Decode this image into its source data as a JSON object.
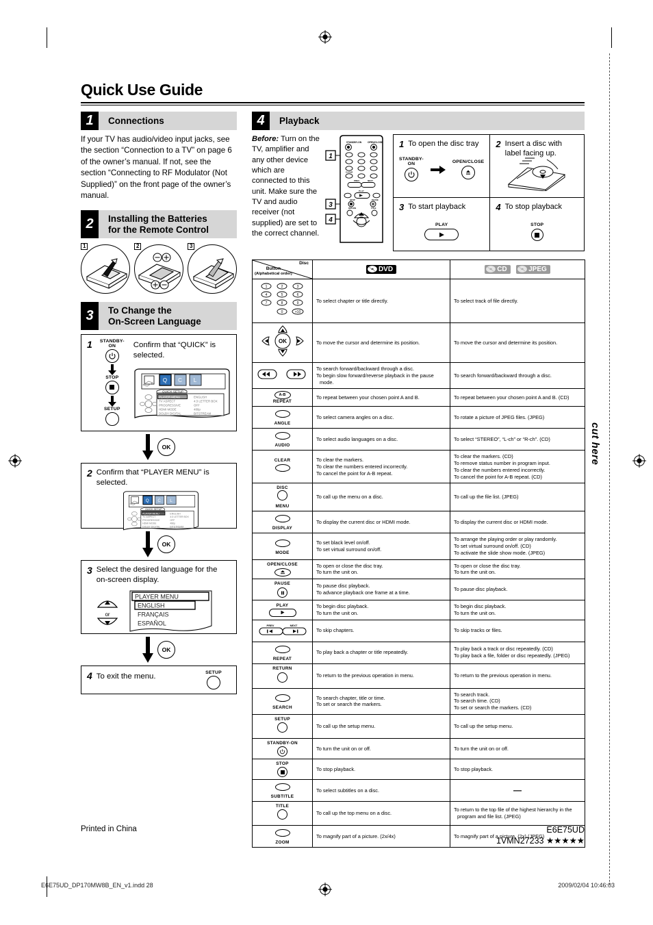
{
  "document": {
    "title": "Quick Use Guide",
    "printed_in": "Printed in China",
    "model_code": "E6E75UD",
    "part_number": "1VMN27233",
    "stars": "★★★★★",
    "cut_here": "cut here",
    "indd_file": "E6E75UD_DP170MW8B_EN_v1.indd   28",
    "print_timestamp": "2009/02/04   10:46:03"
  },
  "sections": {
    "connections": {
      "number": "1",
      "title": "Connections",
      "body": "If your TV has audio/video input jacks, see the section “Connection to a TV” on page 6 of the owner’s manual. If not, see the section “Connecting to RF Modulator (Not Supplied)” on the front page of the owner’s manual."
    },
    "batteries": {
      "number": "2",
      "title_line1": "Installing the Batteries",
      "title_line2": "for the Remote Control",
      "steps": [
        "1",
        "2",
        "3"
      ]
    },
    "language": {
      "number": "3",
      "title_line1": "To Change the",
      "title_line2": "On-Screen Language",
      "step1": {
        "num": "1",
        "text": "Confirm that “QUICK” is selected.",
        "buttons": [
          "STANDBY-ON",
          "STOP",
          "SETUP"
        ]
      },
      "step2": {
        "num": "2",
        "text": "Confirm that “PLAYER MENU” is selected."
      },
      "step3": {
        "num": "3",
        "text": "Select the desired language for the on-screen display.",
        "or_label": "or",
        "menu_title": "PLAYER MENU",
        "menu_options": [
          "ENGLISH",
          "FRANÇAIS",
          "ESPAÑOL"
        ]
      },
      "step4": {
        "num": "4",
        "text": "To exit the menu.",
        "button": "SETUP"
      },
      "ok_label": "OK",
      "osd": {
        "header": "QUICK SETUP",
        "rows": [
          {
            "label": "PLAYER MENU",
            "value": "ENGLISH"
          },
          {
            "label": "TV ASPECT",
            "value": "4:3 LETTER BOX"
          },
          {
            "label": "PROGRESSIVE",
            "value": "OFF"
          },
          {
            "label": "HDMI MODE",
            "value": "480p"
          },
          {
            "label": "DOLBY DIGITAL",
            "value": "BITSTREAM"
          }
        ]
      }
    },
    "playback": {
      "number": "4",
      "title": "Playback",
      "before_label": "Before:",
      "before_text": "Turn on the TV, amplifier and any other device which are connected to this unit. Make sure the TV and audio receiver (not supplied) are set to the correct channel.",
      "remote_callouts": [
        "1",
        "3",
        "4"
      ],
      "remote_labels": {
        "standby": "STANDBY-ON",
        "open_close": "OPEN/CLOSE",
        "clear": "CLEAR",
        "prev": "PREV",
        "next": "NEXT",
        "play": "PLAY",
        "stop": "STOP",
        "return": "RETURN",
        "pause": "PAUSE",
        "title": "TITLE"
      },
      "cells": [
        {
          "num": "1",
          "text": "To open the disc tray",
          "icon_labels": [
            "STANDBY-ON",
            "OPEN/CLOSE"
          ]
        },
        {
          "num": "2",
          "text": "Insert a disc with label facing up.",
          "icon_labels": []
        },
        {
          "num": "3",
          "text": "To start playback",
          "icon_labels": [
            "PLAY"
          ]
        },
        {
          "num": "4",
          "text": "To stop playback",
          "icon_labels": [
            "STOP"
          ]
        }
      ]
    }
  },
  "ops_table": {
    "corner_button_label_1": "Button",
    "corner_button_label_2": "(Alphabetical order)",
    "corner_disc_label": "Disc",
    "col_dvd": "DVD",
    "col_cd": "CD",
    "col_jpeg": "JPEG",
    "rows": [
      {
        "button": "numbers",
        "button_label": "",
        "dvd": [
          "To select chapter or title directly."
        ],
        "cd": [
          "To select track of file directly."
        ]
      },
      {
        "button": "cursor-ok",
        "button_label": "OK",
        "dvd": [
          "To move the cursor and determine its position."
        ],
        "cd": [
          "To move the cursor and determine its position."
        ]
      },
      {
        "button": "search-fwd-rev",
        "button_label": "",
        "dvd": [
          "To search forward/backward through a disc.",
          "To begin slow forward/reverse playback in the pause mode."
        ],
        "cd": [
          "To search forward/backward through a disc."
        ]
      },
      {
        "button": "ab-repeat",
        "button_label": "REPEAT",
        "button_inner": "A-B",
        "dvd": [
          "To repeat between your chosen point A and B."
        ],
        "cd": [
          "To repeat between your chosen point A and B. (CD)"
        ]
      },
      {
        "button": "angle",
        "button_label": "ANGLE",
        "dvd": [
          "To select camera angles on a disc."
        ],
        "cd": [
          "To rotate a picture of JPEG files. (JPEG)"
        ]
      },
      {
        "button": "audio",
        "button_label": "AUDIO",
        "dvd": [
          "To select audio languages on a disc."
        ],
        "cd": [
          "To select “STEREO”, “L-ch” or “R-ch”. (CD)"
        ]
      },
      {
        "button": "clear",
        "button_label_top": "CLEAR",
        "dvd": [
          "To clear the markers.",
          "To clear the numbers entered incorrectly.",
          "To cancel the point for A-B repeat."
        ],
        "cd": [
          "To clear the markers. (CD)",
          "To remove status number in program input.",
          "To clear the numbers entered incorrectly.",
          "To cancel the point for A-B repeat. (CD)"
        ]
      },
      {
        "button": "disc-menu",
        "button_label_top": "DISC",
        "button_label": "MENU",
        "dvd": [
          "To call up the menu on a disc."
        ],
        "cd": [
          "To call up the file list. (JPEG)"
        ]
      },
      {
        "button": "display",
        "button_label": "DISPLAY",
        "dvd": [
          "To display the current disc or HDMI mode."
        ],
        "cd": [
          "To display the current disc or HDMI mode."
        ]
      },
      {
        "button": "mode",
        "button_label": "MODE",
        "dvd": [
          "To set black level on/off.",
          "To set virtual surround on/off."
        ],
        "cd": [
          "To arrange the playing order or play randomly.",
          "To set virtual surround on/off. (CD)",
          "To activate the slide show mode. (JPEG)"
        ]
      },
      {
        "button": "open-close",
        "button_label_top": "OPEN/CLOSE",
        "dvd": [
          "To open or close the disc tray.",
          "To turn the unit on."
        ],
        "cd": [
          "To open or close the disc tray.",
          "To turn the unit on."
        ]
      },
      {
        "button": "pause",
        "button_label_top": "PAUSE",
        "dvd": [
          "To pause disc playback.",
          "To advance playback one frame at a time."
        ],
        "cd": [
          "To pause disc playback."
        ]
      },
      {
        "button": "play",
        "button_label_top": "PLAY",
        "dvd": [
          "To begin disc playback.",
          "To turn the unit on."
        ],
        "cd": [
          "To begin disc playback.",
          "To turn the unit on."
        ]
      },
      {
        "button": "prev-next",
        "button_label_top": "PREV",
        "button_label_top2": "NEXT",
        "dvd": [
          "To skip chapters."
        ],
        "cd": [
          "To skip tracks or files."
        ]
      },
      {
        "button": "repeat",
        "button_label": "REPEAT",
        "dvd": [
          "To play back a chapter or title repeatedly."
        ],
        "cd": [
          "To play back a track or disc repeatedly. (CD)",
          "To play back a file, folder or disc repeatedly. (JPEG)"
        ]
      },
      {
        "button": "return",
        "button_label_top": "RETURN",
        "dvd": [
          "To return to the previous operation in menu."
        ],
        "cd": [
          "To return to the previous operation in menu."
        ]
      },
      {
        "button": "search",
        "button_label": "SEARCH",
        "dvd": [
          "To search chapter, title or time.",
          "To set or search the markers."
        ],
        "cd": [
          "To search track.",
          "To search time. (CD)",
          "To set or search the markers. (CD)"
        ]
      },
      {
        "button": "setup",
        "button_label_top": "SETUP",
        "dvd": [
          "To call up the setup menu."
        ],
        "cd": [
          "To call up the setup menu."
        ]
      },
      {
        "button": "standby-on",
        "button_label_top": "STANDBY-ON",
        "dvd": [
          "To turn the unit on or off."
        ],
        "cd": [
          "To turn the unit on or off."
        ]
      },
      {
        "button": "stop",
        "button_label_top": "STOP",
        "dvd": [
          "To stop playback."
        ],
        "cd": [
          "To stop playback."
        ]
      },
      {
        "button": "subtitle",
        "button_label": "SUBTITLE",
        "dvd": [
          "To select subtitles on a disc."
        ],
        "cd": [
          "—"
        ]
      },
      {
        "button": "title",
        "button_label_top": "TITLE",
        "dvd": [
          "To call up the top menu on a disc."
        ],
        "cd": [
          "To return to the top file of the highest hierarchy in the program and file list. (JPEG)"
        ]
      },
      {
        "button": "zoom",
        "button_label": "ZOOM",
        "dvd": [
          "To magnify part of a picture. (2x/4x)"
        ],
        "cd": [
          "To magnify part of a picture. (2x) (JPEG)"
        ]
      }
    ]
  }
}
